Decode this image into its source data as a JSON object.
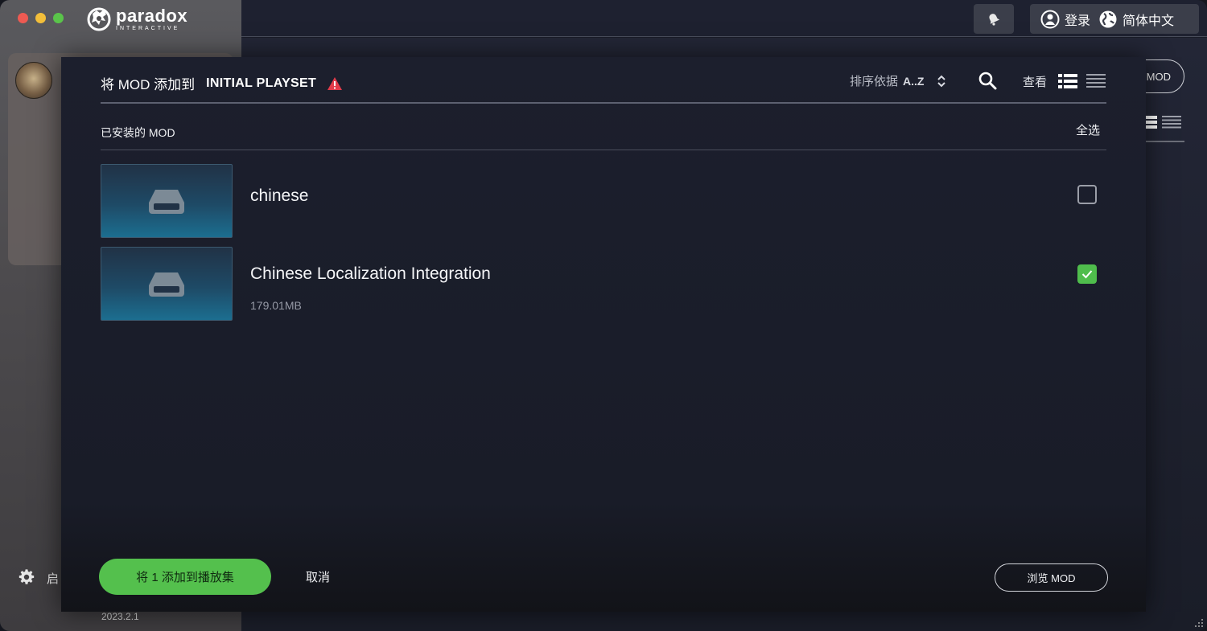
{
  "window": {
    "brand": {
      "name": "paradox",
      "subtitle": "INTERACTIVE"
    }
  },
  "sidebar": {
    "launch_label": "启",
    "version": "2023.2.1"
  },
  "topbar": {
    "login_label": "登录",
    "language_label": "简体中文"
  },
  "background": {
    "mod_button_label": "MOD"
  },
  "dialog": {
    "title_prefix": "将 MOD 添加到",
    "playset_name": "INITIAL PLAYSET",
    "sort_label": "排序依据",
    "sort_value": "A..Z",
    "view_label": "查看",
    "section_title": "已安装的 MOD",
    "select_all_label": "全选",
    "mods": [
      {
        "name": "chinese",
        "size": "",
        "checked": false
      },
      {
        "name": "Chinese Localization Integration",
        "size": "179.01MB",
        "checked": true
      }
    ],
    "add_button_label": "将 1 添加到播放集",
    "cancel_label": "取消",
    "browse_label": "浏览 MOD"
  },
  "colors": {
    "accent_green": "#54c04d",
    "warning_red": "#e23b4a",
    "dialog_bg": "#1c1f2d"
  },
  "icons": [
    "bell-icon",
    "user-icon",
    "globe-icon",
    "warning-icon",
    "sort-chevron-icon",
    "search-icon",
    "grid-view-icon",
    "list-view-icon",
    "drive-icon",
    "checkmark-icon",
    "gear-icon"
  ]
}
